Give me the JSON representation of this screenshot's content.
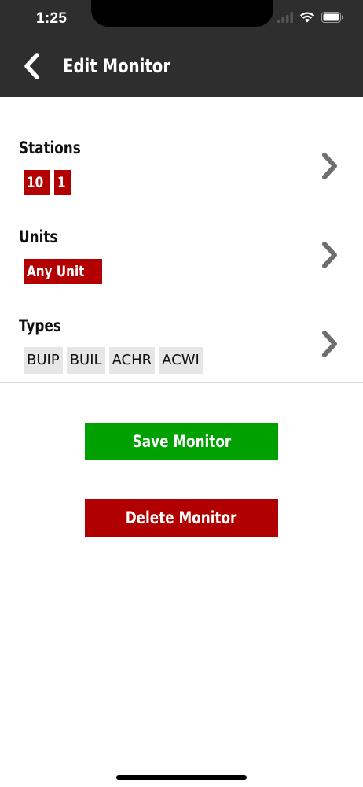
{
  "status_bar": {
    "time": "1:25"
  },
  "nav": {
    "title": "Edit Monitor"
  },
  "rows": [
    {
      "title": "Stations",
      "tags": [
        "10",
        "1"
      ]
    },
    {
      "title": "Units",
      "tags": [
        "Any Unit"
      ]
    },
    {
      "title": "Types",
      "tags": [
        "BUIP",
        "BUIL",
        "ACHR",
        "ACWI"
      ]
    }
  ],
  "buttons": {
    "save_label": "Save Monitor",
    "delete_label": "Delete Monitor"
  },
  "colors": {
    "nav_background": "#2e2e2e",
    "tag_red": "#b30000",
    "tag_gray": "#e6e6e6",
    "save_green": "#00a000",
    "delete_red": "#b00000"
  }
}
